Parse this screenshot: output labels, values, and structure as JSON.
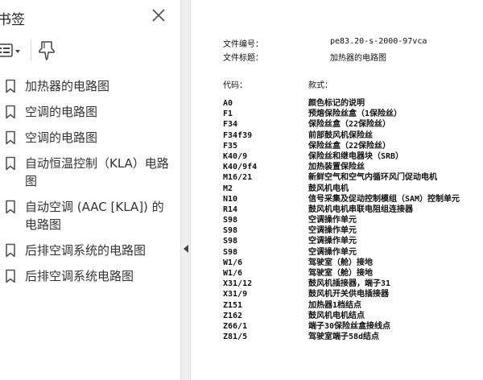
{
  "sidebar": {
    "title": "书签",
    "bookmarks": [
      {
        "label": "加热器的电路图"
      },
      {
        "label": "空调的电路图"
      },
      {
        "label": "空调的电路图"
      },
      {
        "label": "自动恒温控制（KLA）电路图"
      },
      {
        "label": "自动空调 (AAC [KLA]) 的电路图"
      },
      {
        "label": "后排空调系统的电路图"
      },
      {
        "label": "后排空调系统电路图"
      }
    ]
  },
  "document": {
    "file_number_label": "文件编号：",
    "file_number": "pe83.20-s-2000-97vca",
    "file_title_label": "文件标题：",
    "file_title": "加热器的电路图",
    "code_header": "代码：",
    "desc_header": "款式：",
    "rows": [
      {
        "code": "A0",
        "desc": "颜色标记的说明"
      },
      {
        "code": "F1",
        "desc": "预熔保险丝盒（1保险丝）"
      },
      {
        "code": "F34",
        "desc": "保险丝盒（22保险丝）"
      },
      {
        "code": "F34f39",
        "desc": "前部鼓风机保险丝"
      },
      {
        "code": "F35",
        "desc": "保险丝盒（22保险丝）"
      },
      {
        "code": "K40/9",
        "desc": "保险丝和继电器块（SRB）"
      },
      {
        "code": "K40/9f4",
        "desc": "加热装置保险丝"
      },
      {
        "code": "M16/21",
        "desc": "新鲜空气和空气内循环风门促动电机"
      },
      {
        "code": "M2",
        "desc": "鼓风机电机"
      },
      {
        "code": "N10",
        "desc": "信号采集及促动控制模组（SAM）控制单元"
      },
      {
        "code": "R14",
        "desc": "鼓风机电机串联电阻组连接器"
      },
      {
        "code": "S98",
        "desc": "空调操作单元"
      },
      {
        "code": "S98",
        "desc": "空调操作单元"
      },
      {
        "code": "S98",
        "desc": "空调操作单元"
      },
      {
        "code": "S98",
        "desc": "空调操作单元"
      },
      {
        "code": "W1/6",
        "desc": "驾驶室（舱）接地"
      },
      {
        "code": "W1/6",
        "desc": "驾驶室（舱）接地"
      },
      {
        "code": "X31/12",
        "desc": "鼓风机插接器，端子31"
      },
      {
        "code": "X31/9",
        "desc": "鼓风机开关供电插接器"
      },
      {
        "code": "Z151",
        "desc": "加热器1档结点"
      },
      {
        "code": "Z162",
        "desc": "鼓风机电机结点"
      },
      {
        "code": "Z66/1",
        "desc": "端子30保险丝盒接线点"
      },
      {
        "code": "Z81/5",
        "desc": "驾驶室端子58d结点"
      }
    ]
  },
  "icons": {
    "close": "close-icon",
    "options": "options-menu-icon",
    "find": "find-bookmark-icon",
    "bookmark": "bookmark-icon",
    "collapse": "collapse-left-icon"
  },
  "colors": {
    "icon_gray": "#555555",
    "text": "#333333",
    "divider_bg": "#efefef"
  }
}
